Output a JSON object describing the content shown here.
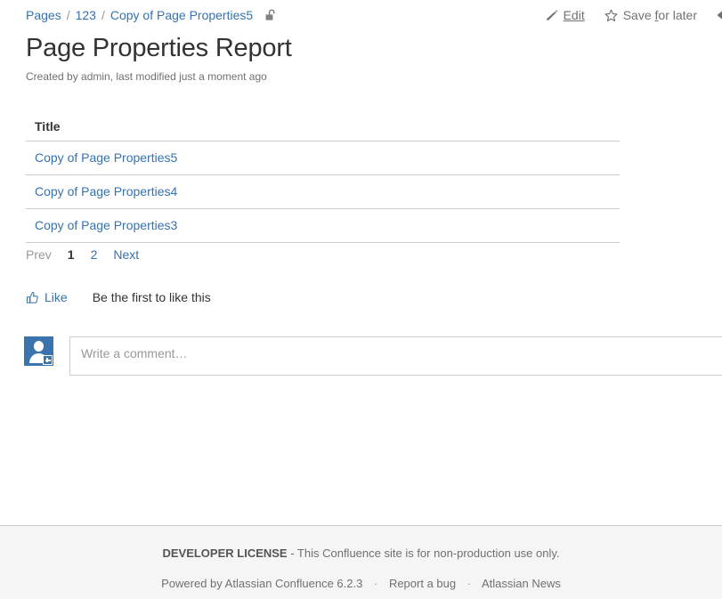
{
  "breadcrumb": {
    "items": [
      {
        "label": "Pages"
      },
      {
        "label": "123"
      },
      {
        "label": "Copy of Page Properties5"
      }
    ],
    "separator": "/",
    "restriction_icon": "unlocked-padlock-icon"
  },
  "actions": {
    "edit": {
      "label": "Edit",
      "icon": "pencil-icon"
    },
    "save_for_later": {
      "label": "Save for later",
      "icon": "star-icon"
    },
    "collapse": {
      "icon": "caret-left-icon"
    }
  },
  "page": {
    "title": "Page Properties Report",
    "byline": "Created by admin, last modified just a moment ago"
  },
  "table": {
    "columns": [
      "Title"
    ],
    "rows": [
      [
        "Copy of Page Properties5"
      ],
      [
        "Copy of Page Properties4"
      ],
      [
        "Copy of Page Properties3"
      ]
    ]
  },
  "pagination": {
    "prev_label": "Prev",
    "pages": [
      "1",
      "2"
    ],
    "current_page": "1",
    "next_label": "Next"
  },
  "likes": {
    "like_label": "Like",
    "like_icon": "thumbs-up-icon",
    "note": "Be the first to like this"
  },
  "comment": {
    "placeholder": "Write a comment…",
    "value": "",
    "avatar_icon": "user-avatar-add-icon"
  },
  "footer": {
    "license_bold": "DEVELOPER LICENSE",
    "license_text": " - This Confluence site is for non-production use only.",
    "powered_by": "Powered by Atlassian Confluence 6.2.3",
    "report_bug": "Report a bug",
    "news": "Atlassian News",
    "separator": "·"
  },
  "colors": {
    "link": "#3572b0",
    "text": "#333333",
    "muted": "#707070",
    "border": "#cccccc",
    "footer_bg": "#f5f5f5",
    "avatar_blue": "#3b73af"
  }
}
